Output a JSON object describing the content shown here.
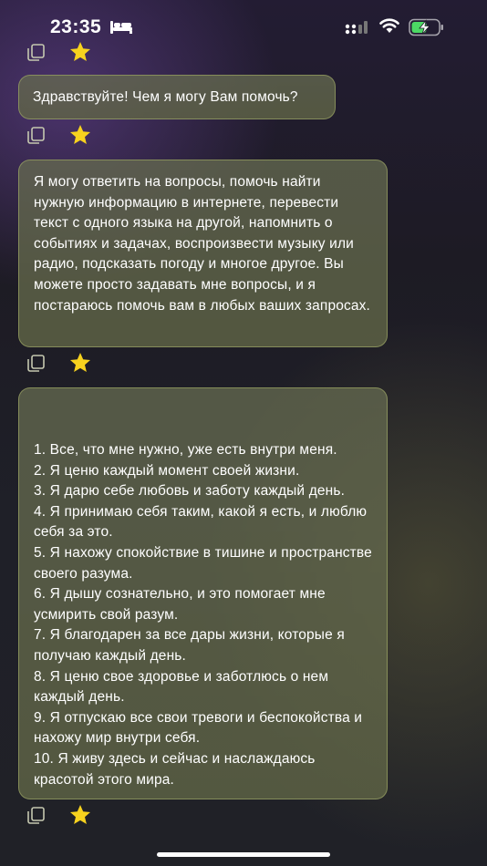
{
  "status_bar": {
    "time": "23:35"
  },
  "icons": {
    "sleep": "bed-icon",
    "signal": "cellular-signal-icon",
    "wifi": "wifi-icon",
    "battery": "battery-charging-icon",
    "copy": "copy-icon",
    "favorite": "star-icon"
  },
  "colors": {
    "star": "#f7d21e",
    "battery_charge": "#4cd964",
    "bubble_border": "#aab96e"
  },
  "messages": [
    {
      "text": "Здравствуйте! Чем я могу Вам помочь?"
    },
    {
      "text": "Я могу ответить на вопросы, помочь найти нужную информацию в интернете, перевести текст с одного языка на другой, напомнить о событиях и задачах, воспроизвести музыку или радио, подсказать погоду и многое другое. Вы можете просто задавать мне вопросы, и я постараюсь помочь вам в любых ваших запросах."
    },
    {
      "items": [
        "1. Все, что мне нужно, уже есть внутри меня.",
        "2. Я ценю каждый момент своей жизни.",
        "3. Я дарю себе любовь и заботу каждый день.",
        "4. Я принимаю себя таким, какой я есть, и люблю себя за это.",
        "5. Я нахожу спокойствие в тишине и пространстве своего разума.",
        "6. Я дышу сознательно, и это помогает мне усмирить свой разум.",
        "7. Я благодарен за все дары жизни, которые я получаю каждый день.",
        "8. Я ценю свое здоровье и заботлюсь о нем каждый день.",
        "9. Я отпускаю все свои тревоги и беспокойства и нахожу мир внутри себя.",
        "10. Я живу здесь и сейчас и наслаждаюсь красотой этого мира."
      ]
    }
  ]
}
